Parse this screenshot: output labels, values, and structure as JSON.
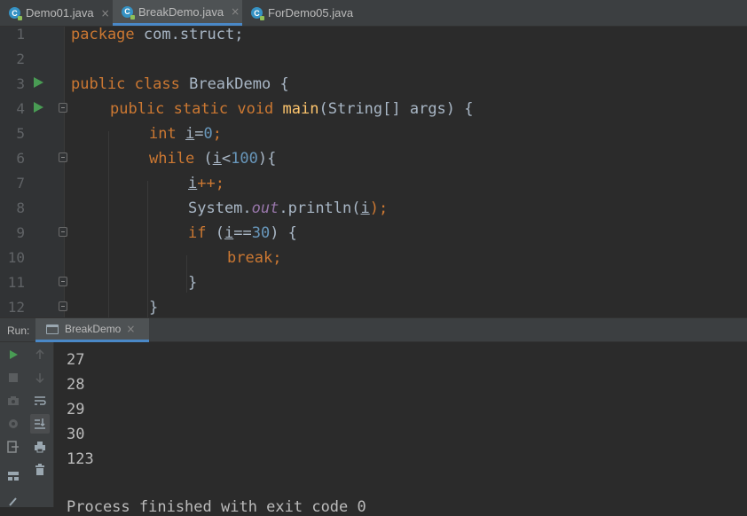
{
  "tabs": [
    {
      "label": "Demo01.java",
      "close": "×"
    },
    {
      "label": "BreakDemo.java",
      "close": "×"
    },
    {
      "label": "ForDemo05.java"
    }
  ],
  "file_icon_letter": "C",
  "line_numbers": [
    "1",
    "2",
    "3",
    "4",
    "5",
    "6",
    "7",
    "8",
    "9",
    "10",
    "11",
    "12"
  ],
  "code": {
    "l1": {
      "kw": "package",
      "rest": " com.struct;"
    },
    "l3": {
      "kw1": "public",
      "kw2": "class",
      "name": " BreakDemo {"
    },
    "l4": {
      "kw1": "public",
      "kw2": "static",
      "kw3": "void",
      "fn": "main",
      "rest": "(String[] args) {"
    },
    "l5": {
      "kw": "int",
      "var": "i",
      "eq": "=",
      "num": "0",
      "semi": ";"
    },
    "l6": {
      "kw": "while",
      "open": " (",
      "var": "i",
      "op": "<",
      "num": "100",
      "close": "){"
    },
    "l7": {
      "var": "i",
      "rest": "++;"
    },
    "l8": {
      "cls": "System.",
      "fld": "out",
      "call": ".println(",
      "var": "i",
      "close": ");"
    },
    "l9": {
      "kw": "if",
      "open": " (",
      "var": "i",
      "op": "==",
      "num": "30",
      "close": ") {"
    },
    "l10": {
      "kw": "break",
      "semi": ";"
    },
    "l11": {
      "brace": "}"
    },
    "l12": {
      "brace": "}"
    }
  },
  "run": {
    "label": "Run:",
    "tab_label": "BreakDemo",
    "tab_close": "×",
    "output": [
      "27",
      "28",
      "29",
      "30",
      "123",
      "",
      "Process finished with exit code 0"
    ]
  },
  "colors": {
    "keyword": "#cc7832",
    "number": "#6897bb",
    "function": "#ffc66d",
    "field": "#9876aa",
    "run_green": "#499c54",
    "tab_accent": "#4a88c7"
  }
}
